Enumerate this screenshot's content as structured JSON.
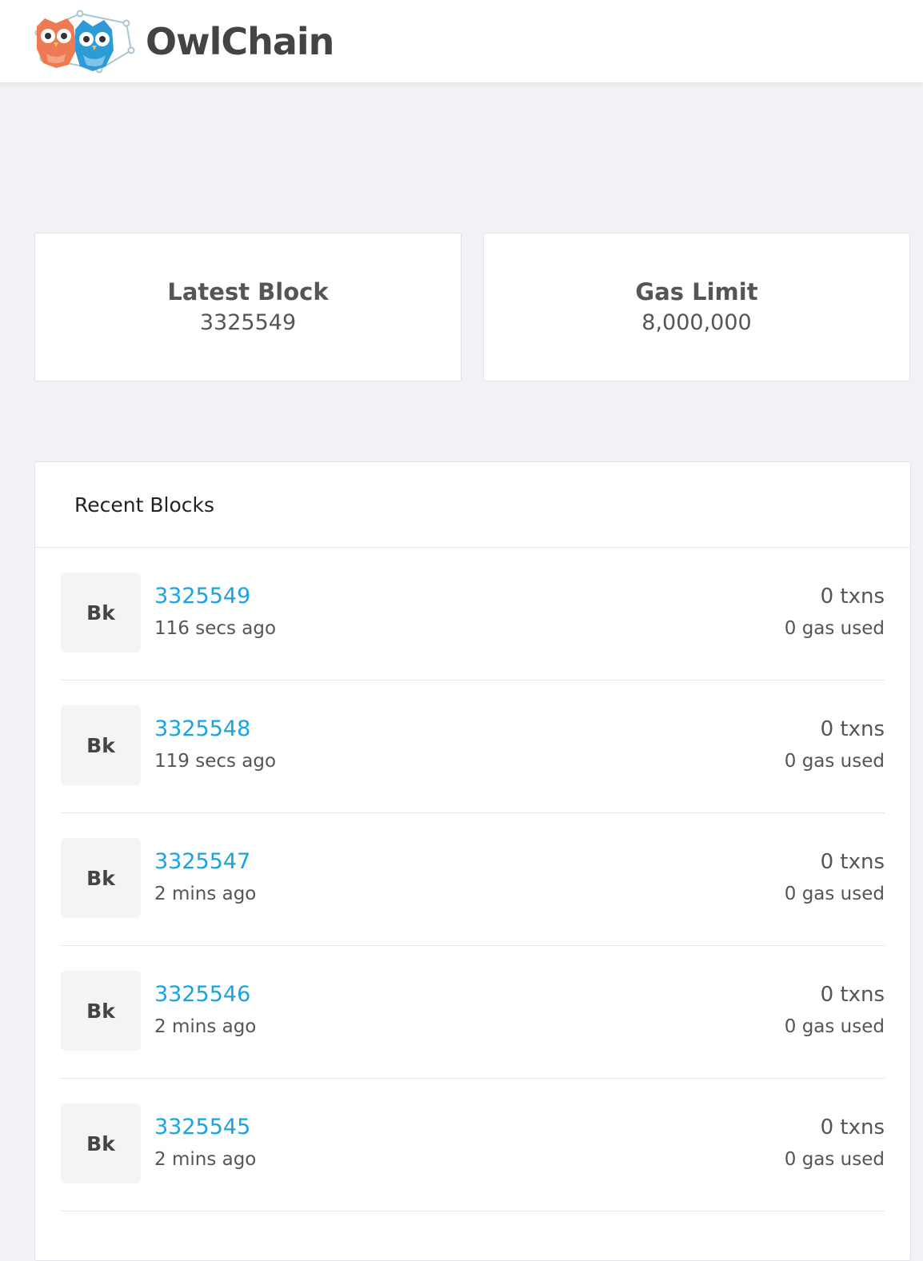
{
  "header": {
    "brand_name": "OwlChain",
    "logo_icon": "owl-pair-logo-icon"
  },
  "colors": {
    "link": "#1aa3e0",
    "background": "#f1f2f5",
    "owl_orange": "#ee7a53",
    "owl_blue": "#2f9bd6"
  },
  "stats": {
    "latest_block": {
      "label": "Latest Block",
      "value": "3325549"
    },
    "gas_limit": {
      "label": "Gas Limit",
      "value": "8,000,000"
    }
  },
  "recent_blocks": {
    "title": "Recent Blocks",
    "items": [
      {
        "badge": "Bk",
        "number": "3325549",
        "age": "116 secs ago",
        "txns": "0 txns",
        "gas": "0 gas used"
      },
      {
        "badge": "Bk",
        "number": "3325548",
        "age": "119 secs ago",
        "txns": "0 txns",
        "gas": "0 gas used"
      },
      {
        "badge": "Bk",
        "number": "3325547",
        "age": "2 mins ago",
        "txns": "0 txns",
        "gas": "0 gas used"
      },
      {
        "badge": "Bk",
        "number": "3325546",
        "age": "2 mins ago",
        "txns": "0 txns",
        "gas": "0 gas used"
      },
      {
        "badge": "Bk",
        "number": "3325545",
        "age": "2 mins ago",
        "txns": "0 txns",
        "gas": "0 gas used"
      }
    ]
  }
}
